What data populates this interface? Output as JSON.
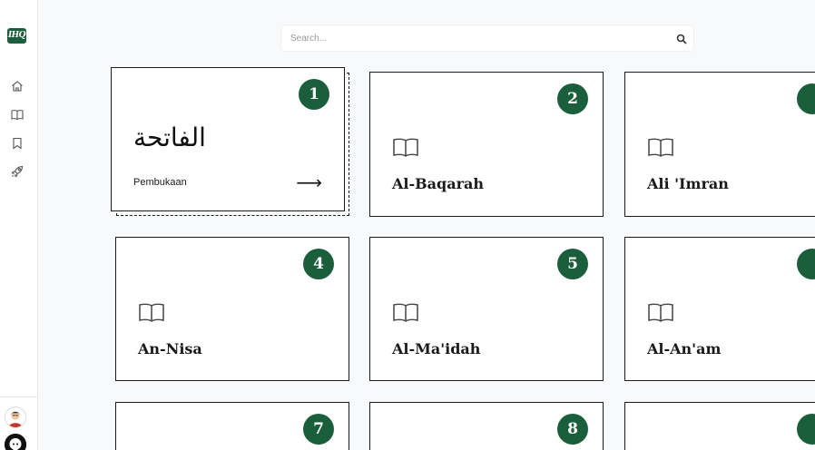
{
  "app": {
    "logo_text": "IHQ"
  },
  "sidebar": {
    "items": [
      {
        "icon": "home-icon"
      },
      {
        "icon": "book-open-icon"
      },
      {
        "icon": "bookmark-icon"
      },
      {
        "icon": "rocket-icon"
      }
    ],
    "footer": [
      {
        "icon": "avatar"
      },
      {
        "icon": "github-icon"
      }
    ]
  },
  "search": {
    "placeholder": "Search..."
  },
  "colors": {
    "accent": "#1b5e3b",
    "border": "#1a1a1a",
    "background": "#f8f9fa"
  },
  "cards": [
    {
      "number": "1",
      "arabic": "الفاتحة",
      "meaning": "Pembukaan",
      "active": true
    },
    {
      "number": "2",
      "name": "Al-Baqarah"
    },
    {
      "number": "",
      "name": "Ali 'Imran"
    },
    {
      "number": "4",
      "name": "An-Nisa"
    },
    {
      "number": "5",
      "name": "Al-Ma'idah"
    },
    {
      "number": "",
      "name": "Al-An'am"
    },
    {
      "number": "7",
      "name": ""
    },
    {
      "number": "8",
      "name": ""
    },
    {
      "number": "",
      "name": ""
    }
  ]
}
